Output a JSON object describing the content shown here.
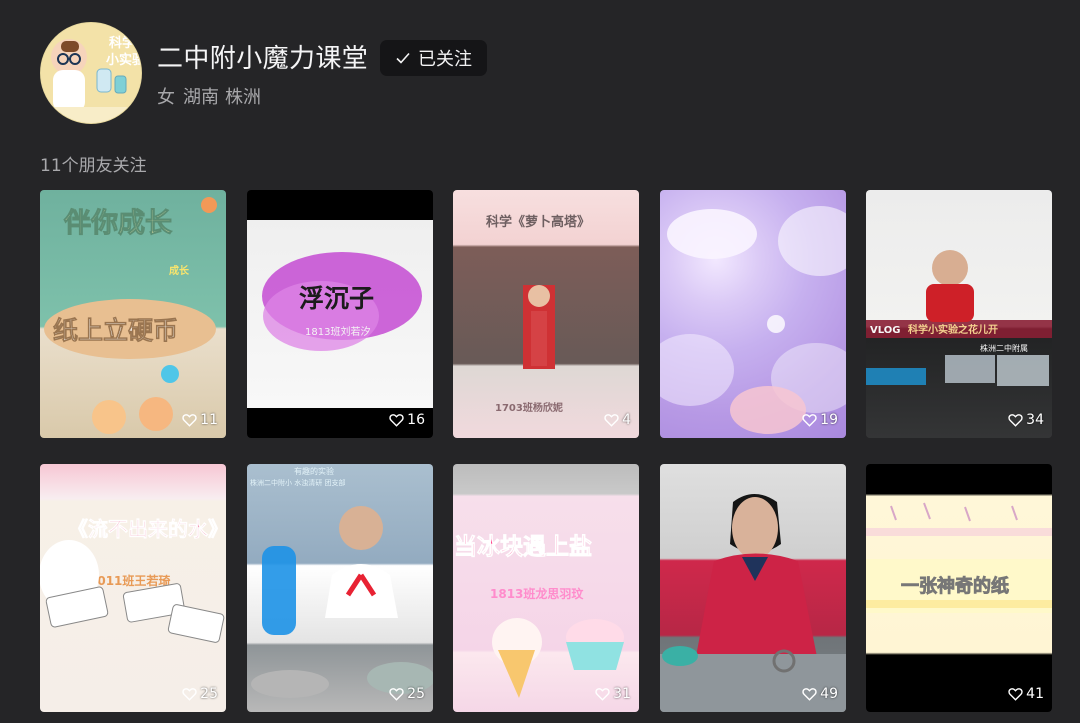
{
  "profile": {
    "name": "二中附小魔力课堂",
    "follow_status": "已关注",
    "gender": "女",
    "province": "湖南",
    "city": "株洲"
  },
  "social": {
    "friends_following": "11个朋友关注"
  },
  "videos": [
    {
      "likes": "11",
      "overlay_text": "纸上立硬币",
      "thumb": "coin-cartoon",
      "top_title": "伴你成长",
      "tag": "成长"
    },
    {
      "likes": "16",
      "overlay_text": "浮沉子",
      "thumb": "purple-splash",
      "subtitle": "1813班刘若汐"
    },
    {
      "likes": "4",
      "overlay_text": "科学《萝卜高塔》",
      "thumb": "girl-tower",
      "subtitle": "1703班杨欣妮"
    },
    {
      "likes": "19",
      "overlay_text": "",
      "thumb": "purple-sky"
    },
    {
      "likes": "34",
      "overlay_text": "科学小实验之花儿开",
      "thumb": "boy-desk",
      "badge": "VLOG",
      "subtitle": "株洲二中附属"
    },
    {
      "likes": "25",
      "overlay_text": "《流不出来的水》",
      "thumb": "rabbit-cartoon",
      "subtitle": "2011班王若琦"
    },
    {
      "likes": "25",
      "overlay_text": "有趣的实验",
      "thumb": "boy-map",
      "subtitle": "株洲二中附小 水浊清研 团支部"
    },
    {
      "likes": "31",
      "overlay_text": "当冰块遇上盐",
      "thumb": "ice-cream",
      "subtitle": "1813班龙思羽玟"
    },
    {
      "likes": "49",
      "overlay_text": "",
      "thumb": "girl-red"
    },
    {
      "likes": "41",
      "overlay_text": "一张神奇的纸",
      "thumb": "yellow-paper"
    }
  ],
  "colors": {
    "background": "#252527",
    "follow_button": "#151517",
    "text_primary": "#f5f5f6",
    "text_secondary": "#a7a7aa"
  },
  "icons": {
    "checkmark": "check-icon",
    "likes": "heart-icon"
  }
}
